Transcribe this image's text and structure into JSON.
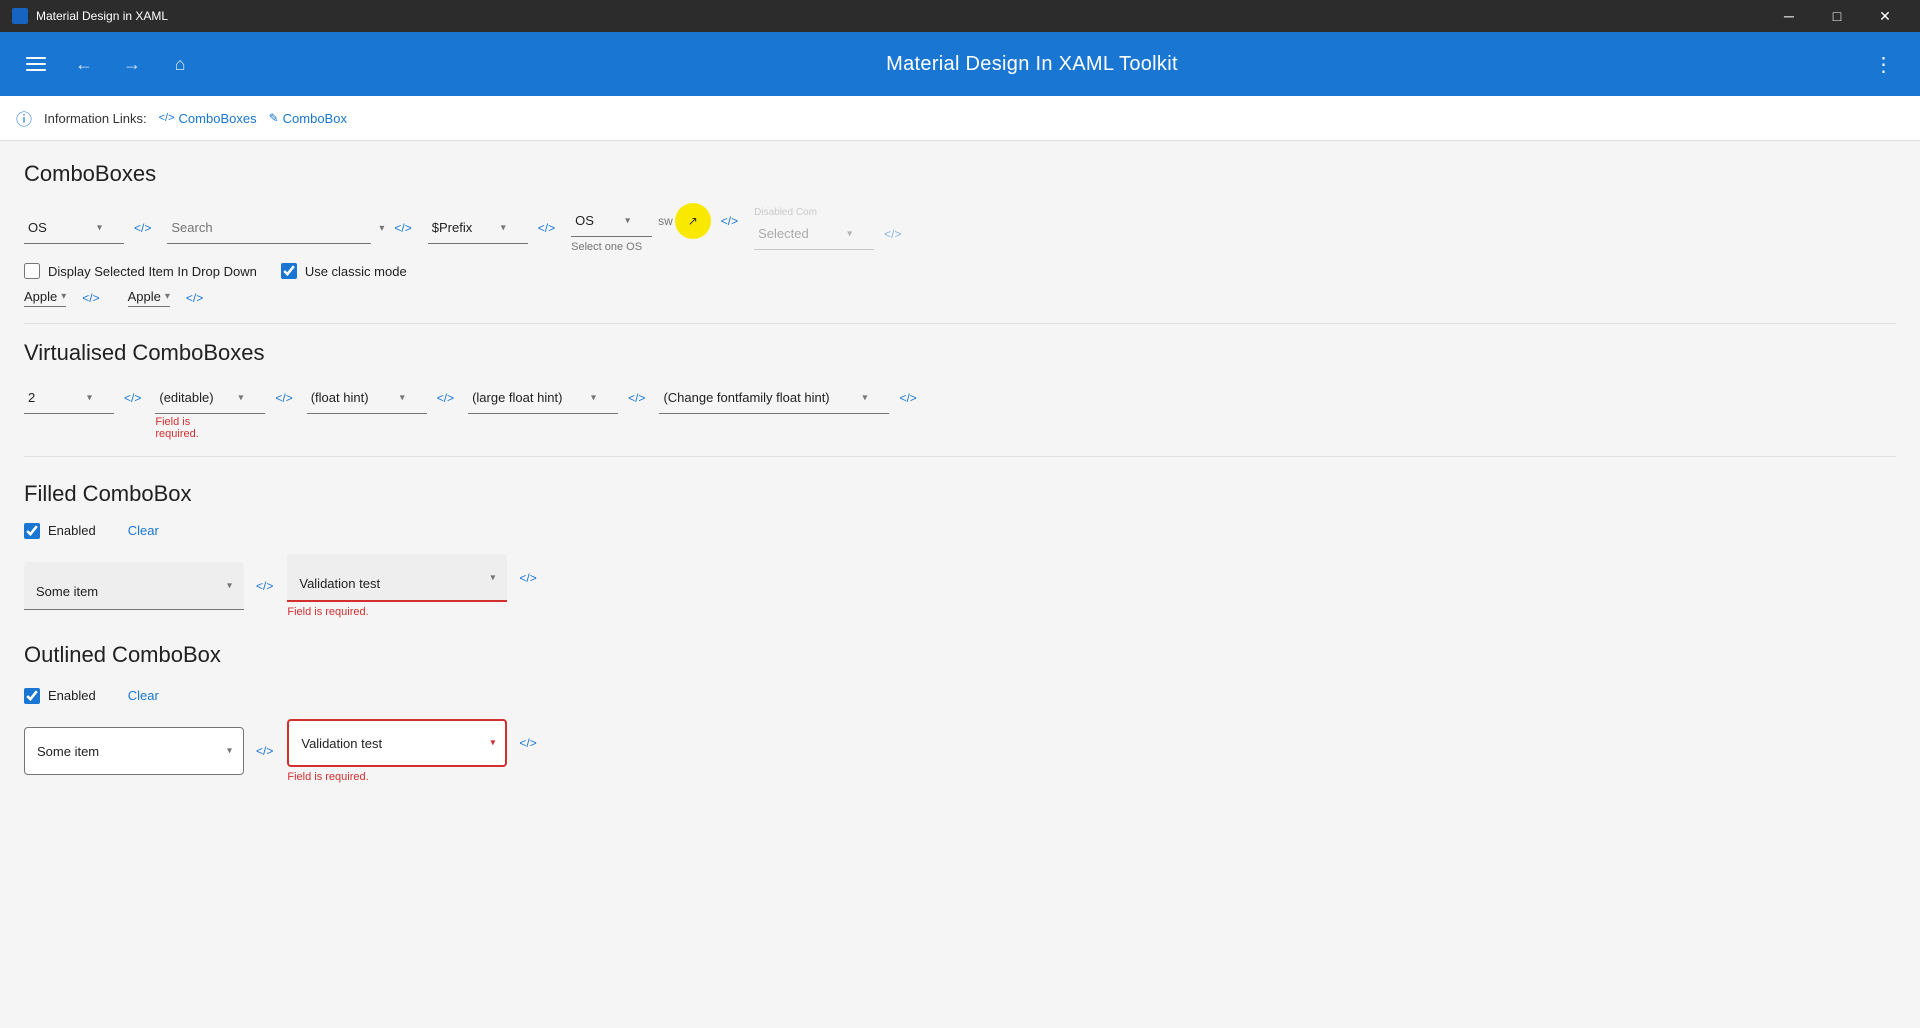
{
  "titleBar": {
    "title": "Material Design in XAML",
    "minimizeBtn": "─",
    "maximizeBtn": "□",
    "closeBtn": "✕"
  },
  "toolbar": {
    "title": "Material Design In XAML Toolkit",
    "hamburgerLabel": "Menu",
    "backLabel": "Back",
    "forwardLabel": "Forward",
    "homeLabel": "Home",
    "moreLabel": "More"
  },
  "infoBar": {
    "label": "Information Links:",
    "links": [
      {
        "text": "ComboBoxes",
        "icon": "<>"
      },
      {
        "text": "ComboBox",
        "icon": "✎"
      }
    ]
  },
  "comboBoxes": {
    "sectionTitle": "ComboBoxes",
    "row1": {
      "combo1": {
        "value": "OS",
        "placeholder": "OS"
      },
      "combo1Code": "</>",
      "combo2": {
        "value": "",
        "placeholder": "Search"
      },
      "combo2Code": "</>",
      "combo3": {
        "value": "$Prefix",
        "placeholder": "$Prefix"
      },
      "combo3Code": "</>",
      "combo4": {
        "value": "OS",
        "placeholder": "OS"
      },
      "combo4extra": "sw",
      "combo4Code": "</>",
      "hint": "Select one OS",
      "disabledLabel": "Disabled Com",
      "combo5": {
        "value": "Selected",
        "placeholder": "Selected"
      },
      "combo5Code": "</>"
    },
    "checkbox1Label": "Display Selected Item In Drop Down",
    "checkbox1Checked": false,
    "checkbox2Label": "Use classic mode",
    "checkbox2Checked": true,
    "apple1": {
      "value": "Apple",
      "code": "</>"
    },
    "apple2": {
      "value": "Apple",
      "code": "</>"
    }
  },
  "virtualisedComboBoxes": {
    "sectionTitle": "Virtualised ComboBoxes",
    "combo1": {
      "value": "2"
    },
    "combo1Code": "</>",
    "combo2": {
      "value": "(editable)",
      "placeholder": "(editable)"
    },
    "combo2Code": "</>",
    "combo3": {
      "value": "(float hint)",
      "placeholder": "(float hint)"
    },
    "combo3Code": "</>",
    "combo4": {
      "value": "(large float hint)",
      "placeholder": "(large float hint)"
    },
    "combo4Code": "</>",
    "combo5": {
      "value": "(Change fontfamily float hint)",
      "placeholder": "(Change fontfamily float hint)"
    },
    "combo5Code": "</>",
    "fieldRequired": "Field is\nrequired."
  },
  "filledComboBox": {
    "sectionTitle": "Filled ComboBox",
    "enabledLabel": "Enabled",
    "enabledChecked": true,
    "clearBtn": "Clear",
    "combo1": {
      "value": "Some item",
      "placeholder": "Some item"
    },
    "combo1Code": "</>",
    "combo2": {
      "value": "Validation test",
      "placeholder": "Validation test"
    },
    "combo2Code": "</>",
    "fieldRequired": "Field is required."
  },
  "outlinedComboBox": {
    "sectionTitle": "Outlined ComboBox",
    "enabledLabel": "Enabled",
    "enabledChecked": true,
    "clearBtn": "Clear",
    "combo1": {
      "value": "Some item",
      "placeholder": "Some item"
    },
    "combo1Code": "</>",
    "combo2": {
      "value": "Validation test",
      "placeholder": "Validation test"
    },
    "combo2Code": "</>",
    "fieldRequired": "Field is required."
  },
  "colors": {
    "primary": "#1976d2",
    "error": "#d32f2f",
    "toolbarBg": "#1976d2"
  }
}
